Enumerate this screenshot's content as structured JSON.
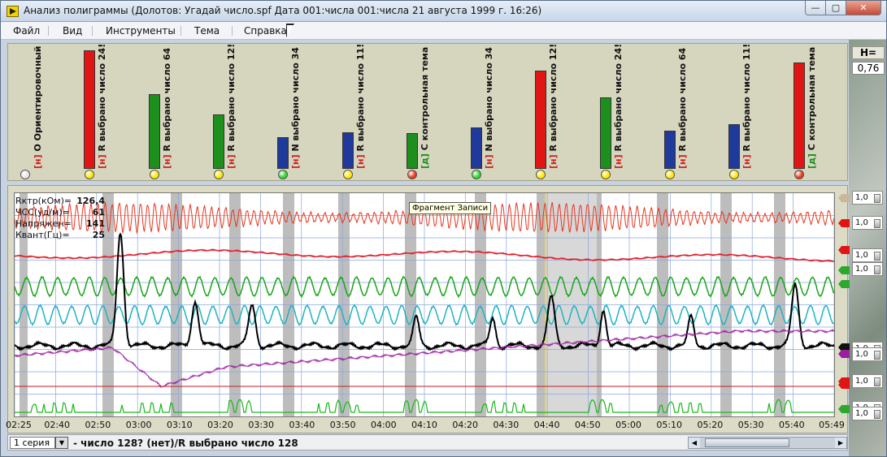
{
  "window": {
    "title": "Анализ полиграммы (Долотов: Угадай число.spf  Дата 001:числа 001:числа 21 августа 1999 г.  16:26)",
    "btn_min": "—",
    "btn_max": "▢",
    "btn_close": "✕"
  },
  "menu": [
    "Файл",
    "Вид",
    "Инструменты",
    "Тема",
    "Справка"
  ],
  "h_label": "H=",
  "h_value": "0,76",
  "questions": [
    {
      "tag": "[н]",
      "label": "О Ориентировочный",
      "value": 0,
      "bar_color": "#ffffff",
      "dot_color": "#e8e8e8"
    },
    {
      "tag": "[н]",
      "label": "R выбрано число 24!",
      "value": 1.0,
      "bar_color": "#e21515",
      "dot_color": "#ffe800"
    },
    {
      "tag": "[н]",
      "label": "R выбрано число 64",
      "value": 0.63,
      "bar_color": "#1d8f1d",
      "dot_color": "#ffe800"
    },
    {
      "tag": "[н]",
      "label": "R выбрано число 12!",
      "value": 0.46,
      "bar_color": "#1d8f1d",
      "dot_color": "#ffe800"
    },
    {
      "tag": "[н]",
      "label": "N выбрано число 34",
      "value": 0.27,
      "bar_color": "#1f3a9a",
      "dot_color": "#2fd82f"
    },
    {
      "tag": "[н]",
      "label": "R выбрано число 11!",
      "value": 0.31,
      "bar_color": "#1f3a9a",
      "dot_color": "#ffe800"
    },
    {
      "tag": "[д]",
      "label": "С контрольная тема",
      "value": 0.3,
      "bar_color": "#1d8f1d",
      "dot_color": "#e83a1a"
    },
    {
      "tag": "[н]",
      "label": "N выбрано число 34",
      "value": 0.35,
      "bar_color": "#1f3a9a",
      "dot_color": "#2fd82f"
    },
    {
      "tag": "[н]",
      "label": "R выбрано число 12!",
      "value": 0.83,
      "bar_color": "#e21515",
      "dot_color": "#ffe800"
    },
    {
      "tag": "[н]",
      "label": "R выбрано число 24!",
      "value": 0.6,
      "bar_color": "#1d8f1d",
      "dot_color": "#ffe800"
    },
    {
      "tag": "[н]",
      "label": "R выбрано число 64",
      "value": 0.32,
      "bar_color": "#1f3a9a",
      "dot_color": "#ffe800"
    },
    {
      "tag": "[н]",
      "label": "R выбрано число 11!",
      "value": 0.38,
      "bar_color": "#1f3a9a",
      "dot_color": "#ffe800"
    },
    {
      "tag": "[д]",
      "label": "С контрольная тема",
      "value": 0.9,
      "bar_color": "#e21515",
      "dot_color": "#e83a1a"
    }
  ],
  "readouts": [
    {
      "label": "Rктр(кОм)=",
      "value": "126,4"
    },
    {
      "label": "ЧСС(уд/м)=",
      "value": "61"
    },
    {
      "label": "Напряжен=",
      "value": "141"
    },
    {
      "label": "Квант(Гц)=",
      "value": "25"
    }
  ],
  "tooltip": "Фрагмент Записи",
  "time_ticks": [
    "02:25",
    "02:40",
    "02:50",
    "03:00",
    "03:10",
    "03:20",
    "03:30",
    "03:40",
    "03:50",
    "04:00",
    "04:10",
    "04:20",
    "04:30",
    "04:40",
    "04:50",
    "05:00",
    "05:10",
    "05:20",
    "05:30",
    "05:40",
    "05:49"
  ],
  "channel_colors": {
    "plethysmo": "#e8351f",
    "pulse": "#e0202e",
    "breath_upper": "#18a418",
    "breath_lower": "#1fb3c2",
    "gsr": "#000000",
    "tremor": "#9c1ea0",
    "threshold": "#c81a1a",
    "motion": "#18b818"
  },
  "scales": [
    "1,0",
    "1,0",
    "1,0",
    "1,0",
    "1,0",
    "1,0",
    "1,0",
    "1,0",
    "1,0"
  ],
  "marker_colors": [
    "#c8b89a",
    "#e21515",
    "#e21515",
    "#2ca82c",
    "#2ca82c",
    "#111111",
    "#9c1ea0",
    "#e21515",
    "#e21515",
    "#2ca82c"
  ],
  "status": {
    "series": "1 серия",
    "text": "- число 128? (нет)/R выбрано число 128"
  }
}
